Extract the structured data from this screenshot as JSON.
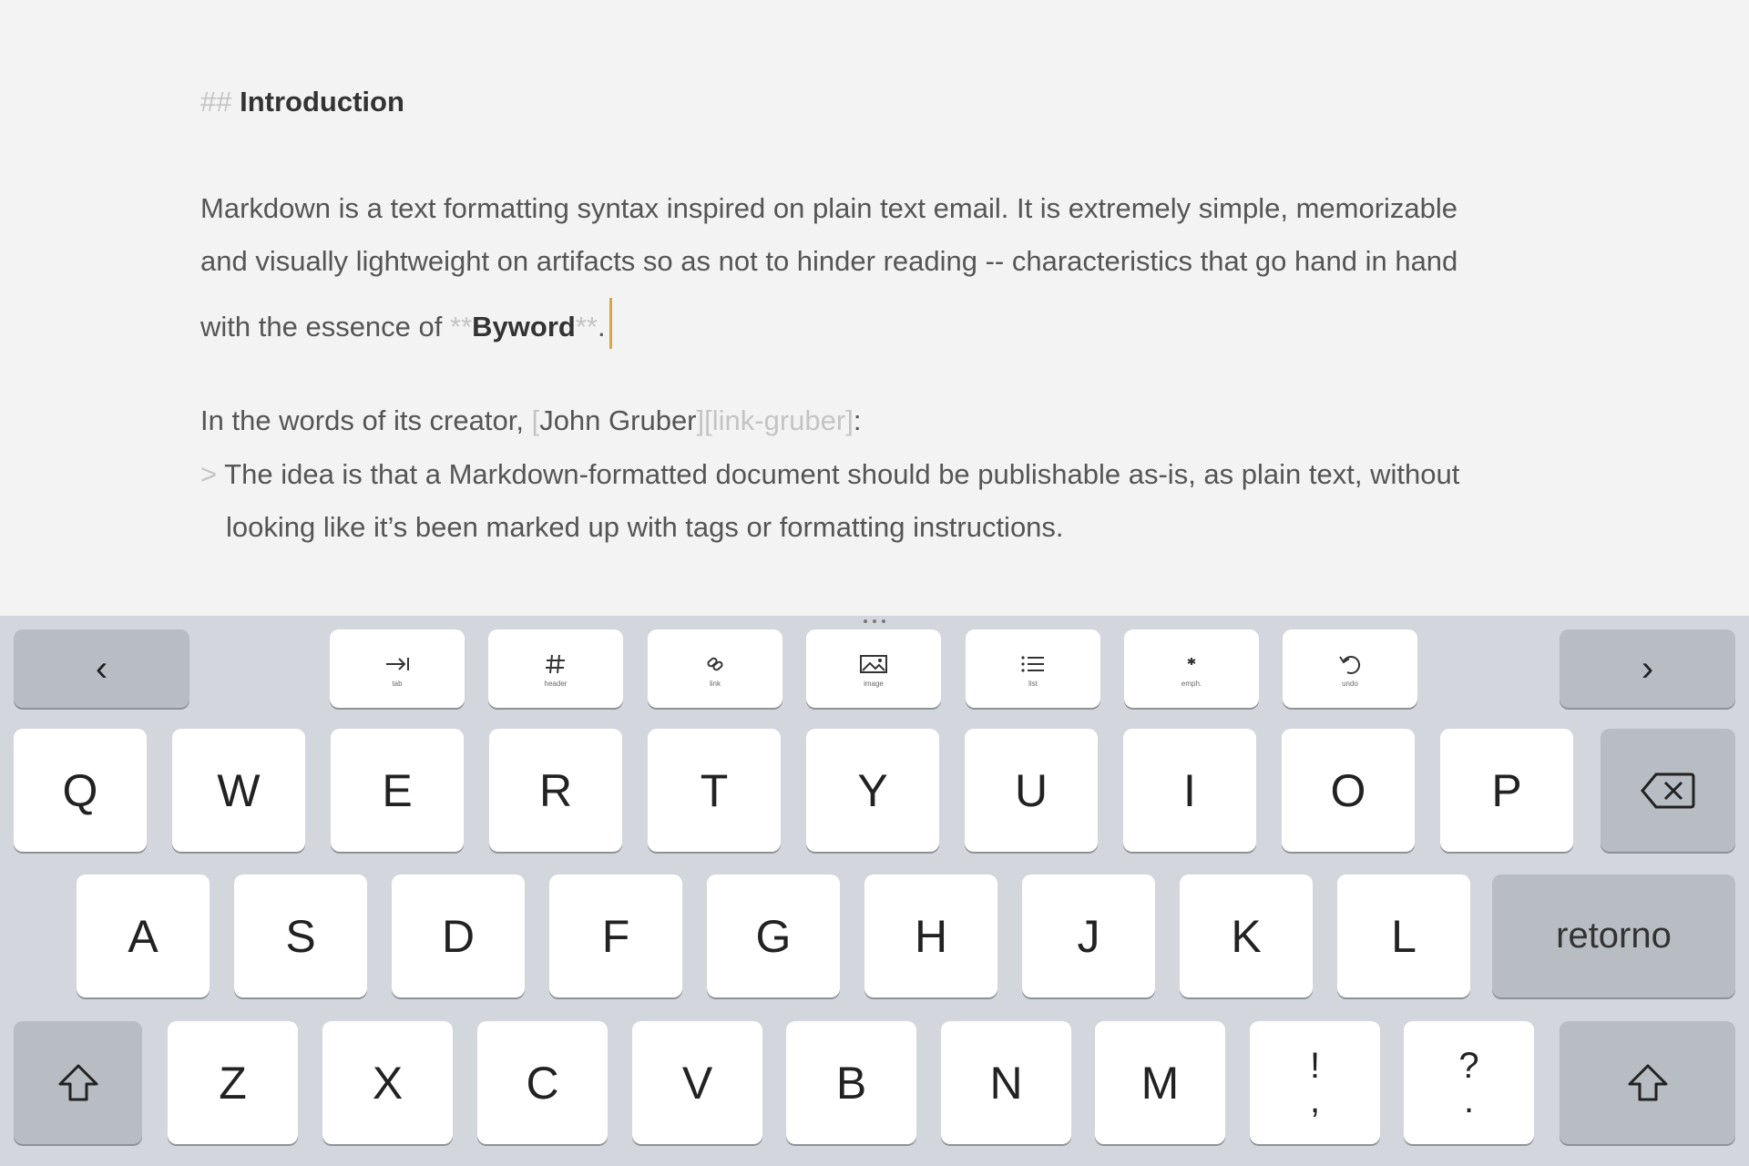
{
  "editor": {
    "heading": {
      "marker": "##",
      "text": "Introduction"
    },
    "para1": {
      "line1": "Markdown is a text formatting syntax inspired on plain text email. It is extremely simple, memorizable",
      "line2": "and visually lightweight on artifacts so as not to hinder reading -- characteristics that go hand in hand",
      "line3_prefix": "with the essence of ",
      "bold_open": "**",
      "bold_text": "Byword",
      "bold_close": "**",
      "line3_end": "."
    },
    "para2": {
      "prefix": "In the words of its creator, ",
      "link_open": "[",
      "link_text": "John Gruber",
      "link_ref": "][link-gruber]",
      "suffix": ":"
    },
    "quote": {
      "marker": ">",
      "line1": "The idea is that a Markdown-formatted document should be publishable as-is, as plain text, without",
      "line2": "looking like it’s been marked up with tags or formatting instructions."
    }
  },
  "toolbar": {
    "prev": "‹",
    "next": "›",
    "keys": [
      {
        "name": "tab",
        "label": "tab"
      },
      {
        "name": "header",
        "label": "header"
      },
      {
        "name": "link",
        "label": "link"
      },
      {
        "name": "image",
        "label": "image"
      },
      {
        "name": "list",
        "label": "list"
      },
      {
        "name": "emph",
        "label": "emph."
      },
      {
        "name": "undo",
        "label": "undo"
      }
    ]
  },
  "keyboard": {
    "row1": [
      "Q",
      "W",
      "E",
      "R",
      "T",
      "Y",
      "U",
      "I",
      "O",
      "P"
    ],
    "row2": [
      "A",
      "S",
      "D",
      "F",
      "G",
      "H",
      "J",
      "K",
      "L"
    ],
    "return_label": "retorno",
    "row3": [
      "Z",
      "X",
      "C",
      "V",
      "B",
      "N",
      "M"
    ],
    "punct1": {
      "top": "!",
      "bottom": ","
    },
    "punct2": {
      "top": "?",
      "bottom": "."
    }
  },
  "colors": {
    "caret": "#d6a648",
    "markup": "#c4c4c4",
    "keyboard_bg": "#d3d6dc"
  }
}
